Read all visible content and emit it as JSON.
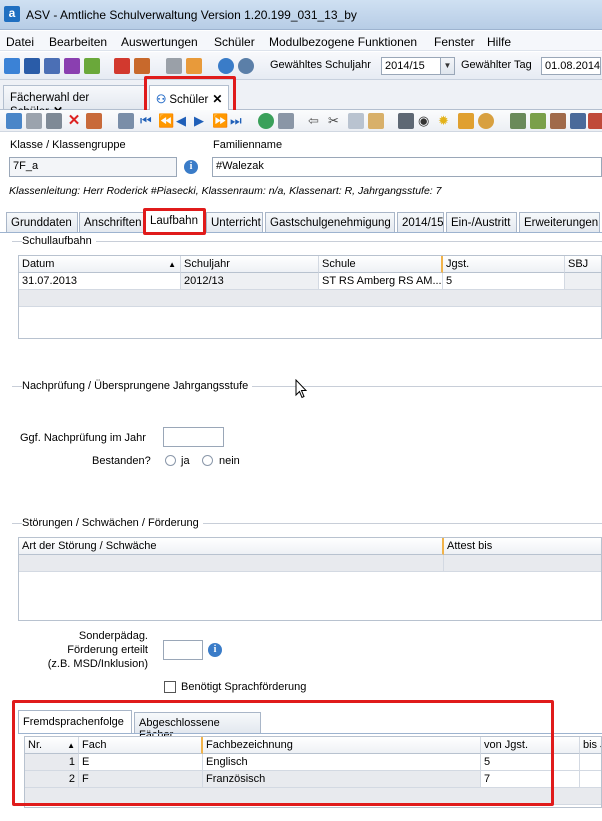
{
  "window": {
    "title": "ASV - Amtliche Schulverwaltung Version 1.20.199_031_13_by",
    "app_icon": "a"
  },
  "menu": [
    "Datei",
    "Bearbeiten",
    "Auswertungen",
    "Schüler",
    "Modulbezogene Funktionen",
    "Fenster",
    "Hilfe"
  ],
  "toolbar": {
    "schuljahr_label": "Gewähltes Schuljahr",
    "schuljahr_value": "2014/15",
    "tag_label": "Gewählter Tag",
    "tag_value": "01.08.2014"
  },
  "doc_tabs": [
    {
      "label": "Fächerwahl der Schüler",
      "close": "✕"
    },
    {
      "label": "Schüler",
      "close": "✕",
      "icon": "people-icon"
    }
  ],
  "header": {
    "klasse_label": "Klasse / Klassengruppe",
    "klasse_value": "7F_a",
    "familienname_label": "Familienname",
    "familienname_value": "#Walezak",
    "info_line": "Klassenleitung: Herr Roderick #Piasecki, Klassenraum: n/a, Klassenart: R, Jahrgangsstufe: 7"
  },
  "content_tabs": [
    "Grunddaten",
    "Anschriften",
    "Laufbahn",
    "Unterricht",
    "Gastschulgenehmigung",
    "2014/15",
    "Ein-/Austritt",
    "Erweiterungen"
  ],
  "schullaufbahn": {
    "title": "Schullaufbahn",
    "columns": [
      "Datum",
      "Schuljahr",
      "Schule",
      "Jgst.",
      "SBJ"
    ],
    "rows": [
      [
        "31.07.2013",
        "2012/13",
        "ST RS Amberg RS AM...",
        "5",
        ""
      ]
    ]
  },
  "nachpruefung": {
    "title": "Nachprüfung / Übersprungene Jahrgangsstufe",
    "im_jahr_label": "Ggf. Nachprüfung im Jahr",
    "bestanden_label": "Bestanden?",
    "ja": "ja",
    "nein": "nein"
  },
  "stoerungen": {
    "title": "Störungen / Schwächen / Förderung",
    "columns": [
      "Art der Störung / Schwäche",
      "Attest bis"
    ],
    "sonder_label_1": "Sonderpädag.",
    "sonder_label_2": "Förderung erteilt",
    "sonder_label_3": "(z.B. MSD/Inklusion)",
    "sprachfoerderung_label": "Benötigt Sprachförderung"
  },
  "fremdsprachen": {
    "tabs": [
      "Fremdsprachenfolge",
      "Abgeschlossene Fächer"
    ],
    "columns": [
      "Nr.",
      "Fach",
      "Fachbezeichnung",
      "von Jgst.",
      "bis J"
    ],
    "rows": [
      [
        "1",
        "E",
        "Englisch",
        "5",
        ""
      ],
      [
        "2",
        "F",
        "Französisch",
        "7",
        ""
      ]
    ]
  },
  "colors": {
    "highlight": "#e01b1b",
    "accent": "#1f6fc1",
    "sort_marker": "#f1b34a"
  }
}
